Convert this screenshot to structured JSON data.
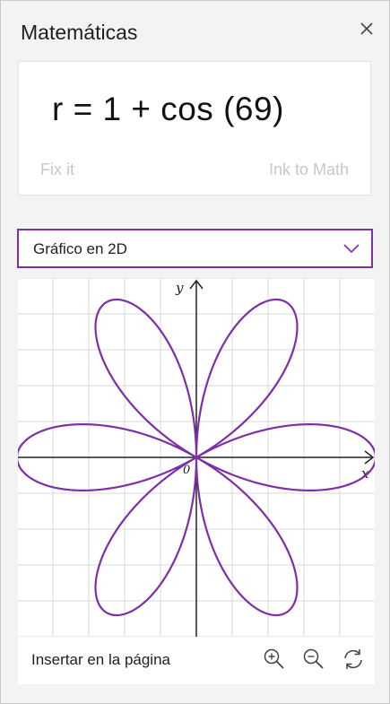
{
  "panel": {
    "title": "Matemáticas"
  },
  "equation_card": {
    "equation": "r = 1 + cos (69)",
    "fix_it": "Fix it",
    "ink_to_math": "Ink to Math"
  },
  "graph_type": {
    "selected": "Gráfico en 2D"
  },
  "graph": {
    "x_label": "x",
    "y_label": "y",
    "origin_label": "0",
    "curve_color": "#7d2fa8",
    "grid_color": "#d9d9d9",
    "axis_color": "#222222"
  },
  "chart_data": {
    "type": "line",
    "title": "",
    "xlabel": "x",
    "ylabel": "y",
    "curve": "polar rose, six petals, petals along the x-axis and at ±60°, ±120°",
    "grid": true
  },
  "bottom_bar": {
    "insert_label": "Insertar en la página",
    "icons": [
      "zoom-in-icon",
      "zoom-out-icon",
      "refresh-icon"
    ]
  },
  "colors": {
    "accent": "#7d2fa8",
    "background": "#f3f3f3",
    "card": "#ffffff"
  }
}
